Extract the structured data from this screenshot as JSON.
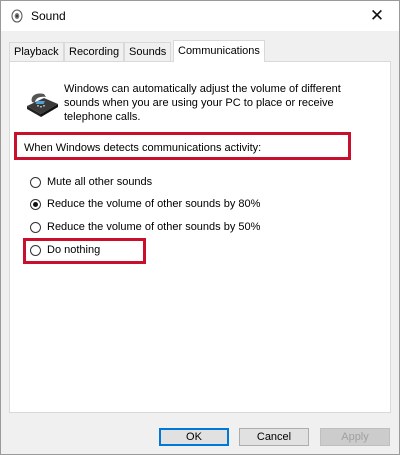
{
  "window": {
    "title": "Sound",
    "close_glyph": "✕"
  },
  "tabs": [
    {
      "label": "Playback"
    },
    {
      "label": "Recording"
    },
    {
      "label": "Sounds"
    },
    {
      "label": "Communications",
      "active": true
    }
  ],
  "communications": {
    "description": "Windows can automatically adjust the volume of different sounds when you are using your PC to place or receive telephone calls.",
    "group_label": "When Windows detects communications activity:",
    "options": [
      {
        "label": "Mute all other sounds",
        "checked": false
      },
      {
        "label": "Reduce the volume of other sounds by 80%",
        "checked": true
      },
      {
        "label": "Reduce the volume of other sounds by 50%",
        "checked": false
      },
      {
        "label": "Do nothing",
        "checked": false
      }
    ]
  },
  "buttons": {
    "ok": "OK",
    "cancel": "Cancel",
    "apply": "Apply"
  },
  "colors": {
    "highlight": "#c8102e",
    "accent": "#0078d7"
  },
  "icons": {
    "title": "speaker-icon",
    "telephone": "telephone-icon",
    "close": "close-icon"
  }
}
